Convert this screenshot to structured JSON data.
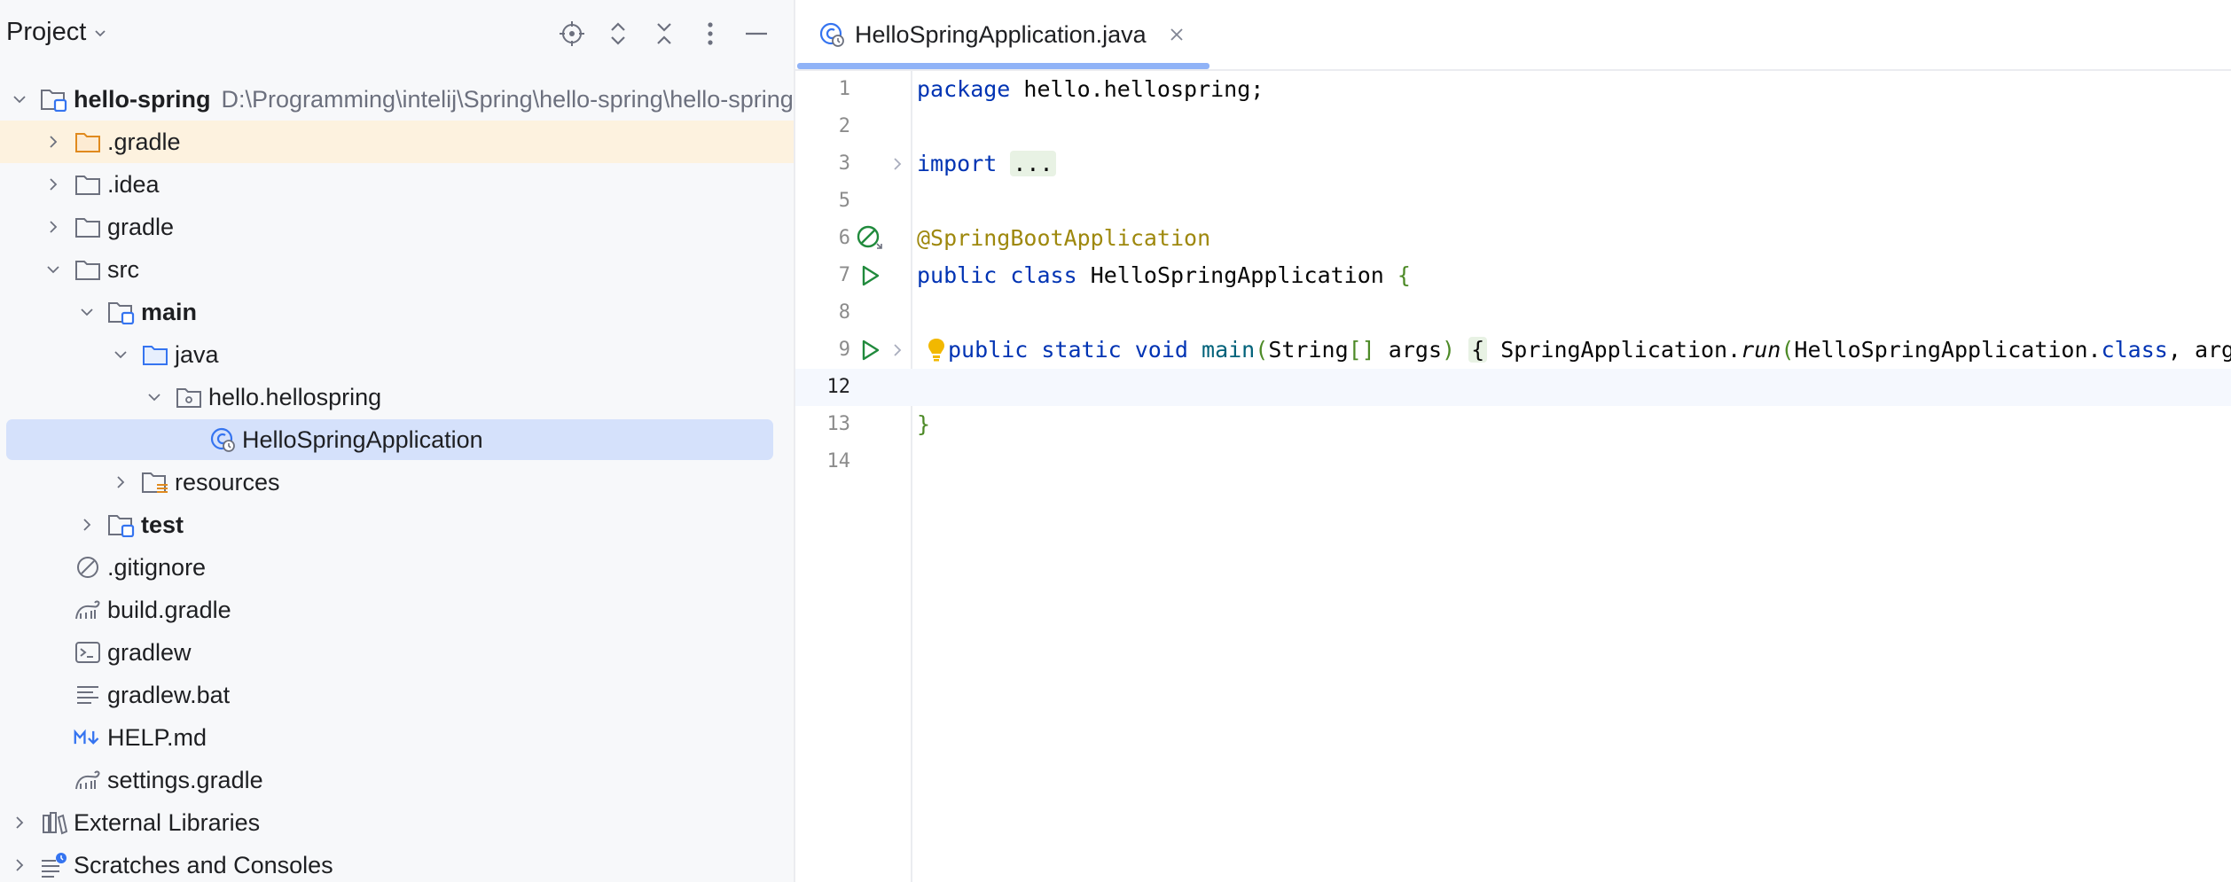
{
  "project_panel": {
    "title": "Project",
    "tree": [
      {
        "label": "hello-spring",
        "path": "D:\\Programming\\intelij\\Spring\\hello-spring\\hello-spring",
        "depth": 0,
        "expanded": true,
        "icon": "module-folder-icon",
        "bold": true
      },
      {
        "label": ".gradle",
        "depth": 1,
        "expanded": false,
        "icon": "folder-orange-icon",
        "highlight": true
      },
      {
        "label": ".idea",
        "depth": 1,
        "expanded": false,
        "icon": "folder-icon"
      },
      {
        "label": "gradle",
        "depth": 1,
        "expanded": false,
        "icon": "folder-icon"
      },
      {
        "label": "src",
        "depth": 1,
        "expanded": true,
        "icon": "folder-icon"
      },
      {
        "label": "main",
        "depth": 2,
        "expanded": true,
        "icon": "module-folder-icon",
        "bold": true
      },
      {
        "label": "java",
        "depth": 3,
        "expanded": true,
        "icon": "source-folder-icon"
      },
      {
        "label": "hello.hellospring",
        "depth": 4,
        "expanded": true,
        "icon": "package-icon"
      },
      {
        "label": "HelloSpringApplication",
        "depth": 5,
        "icon": "spring-class-icon",
        "selected": true
      },
      {
        "label": "resources",
        "depth": 3,
        "expanded": false,
        "icon": "resources-folder-icon"
      },
      {
        "label": "test",
        "depth": 2,
        "expanded": false,
        "icon": "module-folder-icon",
        "bold": true
      },
      {
        "label": ".gitignore",
        "depth": 1,
        "icon": "gitignore-icon"
      },
      {
        "label": "build.gradle",
        "depth": 1,
        "icon": "gradle-icon"
      },
      {
        "label": "gradlew",
        "depth": 1,
        "icon": "terminal-icon"
      },
      {
        "label": "gradlew.bat",
        "depth": 1,
        "icon": "text-file-icon"
      },
      {
        "label": "HELP.md",
        "depth": 1,
        "icon": "markdown-icon"
      },
      {
        "label": "settings.gradle",
        "depth": 1,
        "icon": "gradle-icon"
      },
      {
        "label": "External Libraries",
        "depth": 0,
        "expanded": false,
        "icon": "libraries-icon"
      },
      {
        "label": "Scratches and Consoles",
        "depth": 0,
        "expanded": false,
        "icon": "scratches-icon"
      }
    ]
  },
  "editor": {
    "tab_label": "HelloSpringApplication.java",
    "lines": [
      {
        "num": "1",
        "tokens": [
          {
            "t": "package",
            "c": "kw"
          },
          {
            "t": " hello.hellospring;"
          }
        ]
      },
      {
        "num": "2",
        "tokens": []
      },
      {
        "num": "3",
        "fold": "collapsed",
        "tokens": [
          {
            "t": "import",
            "c": "kw"
          },
          {
            "t": " "
          },
          {
            "t": "...",
            "c": "fold-box"
          }
        ]
      },
      {
        "num": "5",
        "tokens": []
      },
      {
        "num": "6",
        "gutter": "spring-bean-icon",
        "tokens": [
          {
            "t": "@SpringBootApplication",
            "c": "ann"
          }
        ]
      },
      {
        "num": "7",
        "gutter": "run-icon",
        "tokens": [
          {
            "t": "public",
            "c": "kw"
          },
          {
            "t": " "
          },
          {
            "t": "class",
            "c": "kw"
          },
          {
            "t": " HelloSpringApplication "
          },
          {
            "t": "{",
            "c": "br"
          }
        ]
      },
      {
        "num": "8",
        "tokens": []
      },
      {
        "num": "9",
        "gutter": "run-icon",
        "fold": "collapsed",
        "bulb": true,
        "tokens": [
          {
            "t": "public",
            "c": "kw"
          },
          {
            "t": " "
          },
          {
            "t": "static",
            "c": "kw"
          },
          {
            "t": " "
          },
          {
            "t": "void",
            "c": "kw"
          },
          {
            "t": " "
          },
          {
            "t": "main",
            "c": "fn"
          },
          {
            "t": "(",
            "c": "br"
          },
          {
            "t": "String"
          },
          {
            "t": "[]",
            "c": "br"
          },
          {
            "t": " args"
          },
          {
            "t": ")",
            "c": "br"
          },
          {
            "t": " "
          },
          {
            "t": "{",
            "c": "fold-box"
          },
          {
            "t": " SpringApplication."
          },
          {
            "t": "run",
            "c": "it"
          },
          {
            "t": "(",
            "c": "br"
          },
          {
            "t": "HelloSpringApplication."
          },
          {
            "t": "class",
            "c": "kw"
          },
          {
            "t": ", args"
          },
          {
            "t": ");",
            "c": "br"
          },
          {
            "t": " "
          },
          {
            "t": "}",
            "c": "fold-box"
          }
        ]
      },
      {
        "num": "12",
        "current": true,
        "tokens": []
      },
      {
        "num": "13",
        "tokens": [
          {
            "t": "}",
            "c": "br"
          }
        ]
      },
      {
        "num": "14",
        "tokens": []
      }
    ]
  },
  "colors": {
    "accent": "#3574f0",
    "selection": "#d5e1fb",
    "highlight_row": "#fdf2df"
  }
}
